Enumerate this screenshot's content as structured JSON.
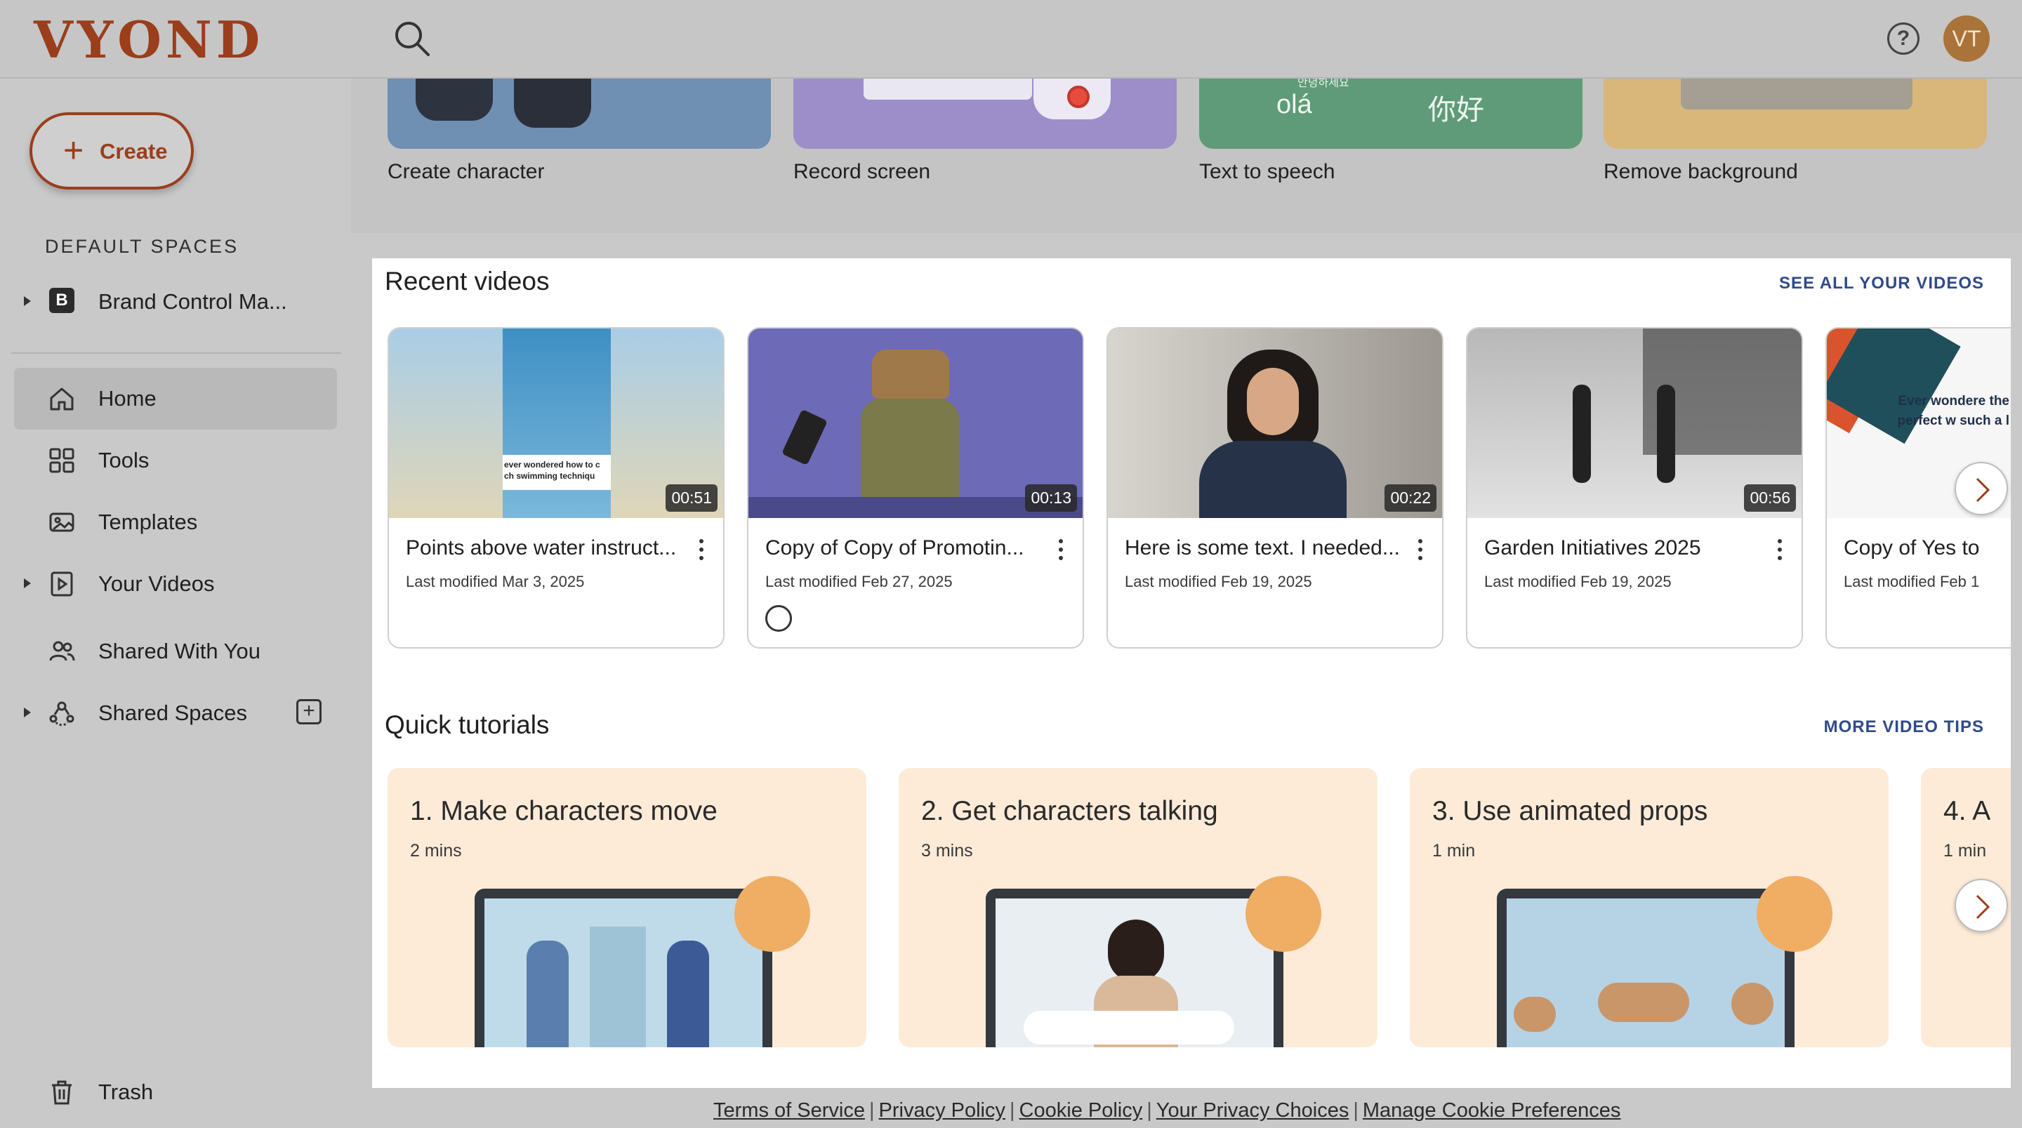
{
  "brand": {
    "logo": "VYOND",
    "accent": "#9a3e1c"
  },
  "topbar": {
    "avatar_initials": "VT"
  },
  "sidebar": {
    "create_label": "Create",
    "section_label": "DEFAULT SPACES",
    "brand_space": {
      "badge": "B",
      "label": "Brand Control Ma..."
    },
    "items": [
      {
        "label": "Home",
        "icon": "home-icon"
      },
      {
        "label": "Tools",
        "icon": "grid-icon"
      },
      {
        "label": "Templates",
        "icon": "templates-icon"
      },
      {
        "label": "Your Videos",
        "icon": "video-icon"
      },
      {
        "label": "Shared With You",
        "icon": "people-icon"
      },
      {
        "label": "Shared Spaces",
        "icon": "spaces-icon"
      }
    ],
    "trash_label": "Trash"
  },
  "tools": [
    {
      "label": "Create character",
      "color": "#6f8fb3"
    },
    {
      "label": "Record screen",
      "color": "#9d8ec9"
    },
    {
      "label": "Text to speech",
      "color": "#5f9b78",
      "text_a": "olá",
      "text_b": "你好",
      "text_c": "안녕하세요"
    },
    {
      "label": "Remove background",
      "color": "#d9b77a"
    }
  ],
  "recent": {
    "title": "Recent videos",
    "link": "SEE ALL YOUR VIDEOS",
    "videos": [
      {
        "title": "Points above water instruct...",
        "date": "Last modified Mar 3, 2025",
        "duration": "00:51",
        "caption": "ever wondered how to c ch swimming techniqu"
      },
      {
        "title": "Copy of Copy of Promotin...",
        "date": "Last modified Feb 27, 2025",
        "duration": "00:13"
      },
      {
        "title": "Here is some text. I needed...",
        "date": "Last modified Feb 19, 2025",
        "duration": "00:22"
      },
      {
        "title": "Garden Initiatives 2025",
        "date": "Last modified Feb 19, 2025",
        "duration": "00:56"
      },
      {
        "title": "Copy of Yes to",
        "date": "Last modified Feb 1",
        "caption": "Ever wondere the perfect w such a l"
      }
    ]
  },
  "tutorials": {
    "title": "Quick tutorials",
    "link": "MORE VIDEO TIPS",
    "items": [
      {
        "title": "1. Make characters move",
        "duration": "2 mins"
      },
      {
        "title": "2. Get characters talking",
        "duration": "3 mins"
      },
      {
        "title": "3. Use animated props",
        "duration": "1 min"
      },
      {
        "title": "4. A",
        "duration": "1 min"
      }
    ]
  },
  "footer": {
    "links": [
      "Terms of Service",
      "Privacy Policy",
      "Cookie Policy",
      "Your Privacy Choices",
      "Manage Cookie Preferences"
    ]
  }
}
